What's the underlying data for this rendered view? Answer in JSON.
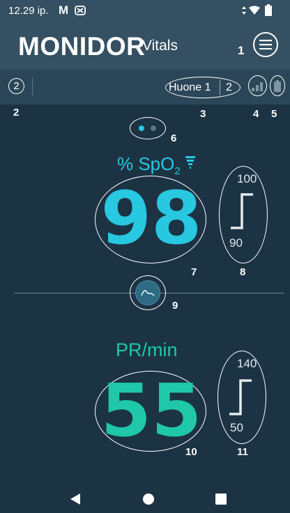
{
  "status_bar": {
    "time": "12.29 ip.",
    "app_icons": [
      "gmail-icon",
      "notification-icon"
    ],
    "system_icons": [
      "data-arrows-icon",
      "wifi-icon",
      "battery-icon"
    ]
  },
  "app_bar": {
    "title_main": "MONIDOR",
    "title_sub": "Vitals",
    "menu_label": "menu"
  },
  "sub_bar": {
    "count_left": "2",
    "room_label": "Huone 1",
    "room_count": "2"
  },
  "page_dots": {
    "active_index": 0,
    "total": 2
  },
  "spo2": {
    "label_prefix": "% SpO",
    "label_subscript": "2",
    "value": "98",
    "alarm_high": "100",
    "alarm_low": "90",
    "color": "#27c8e0"
  },
  "pulse": {
    "label": "PR/min",
    "value": "55",
    "alarm_high": "140",
    "alarm_low": "50",
    "color": "#1ec8a8"
  },
  "callouts": {
    "c1": "1",
    "c2": "2",
    "c3": "3",
    "c4": "4",
    "c5": "5",
    "c6": "6",
    "c7": "7",
    "c8": "8",
    "c9": "9",
    "c10": "10",
    "c11": "11"
  },
  "nav_bar": {
    "back": "back-icon",
    "home": "home-icon",
    "recents": "recents-icon"
  }
}
